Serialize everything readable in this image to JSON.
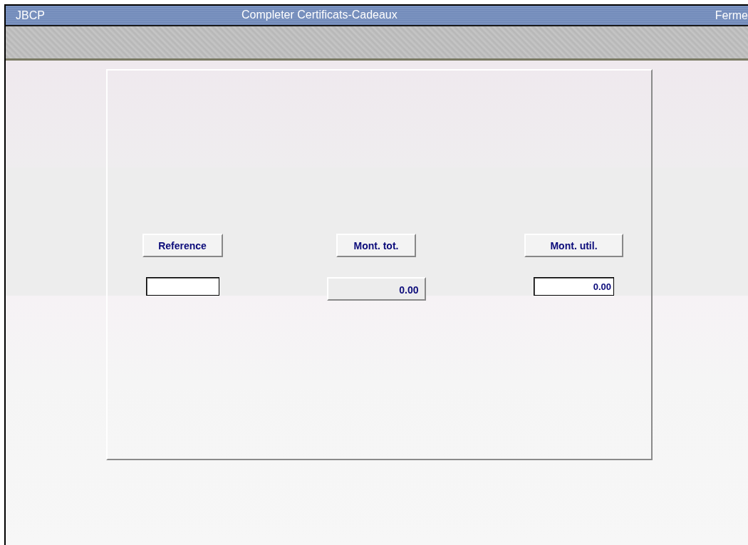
{
  "window": {
    "app_name": "JBCP",
    "title": "Completer Certificats-Cadeaux",
    "close_label": "Ferme"
  },
  "form": {
    "columns": [
      {
        "header": "Reference",
        "field": {
          "kind": "input"
        }
      },
      {
        "header": "Mont. tot.",
        "field": {
          "kind": "display",
          "value": "0.00"
        }
      },
      {
        "header": "Mont. util.",
        "field": {
          "kind": "input",
          "value": "0.00"
        }
      }
    ]
  }
}
